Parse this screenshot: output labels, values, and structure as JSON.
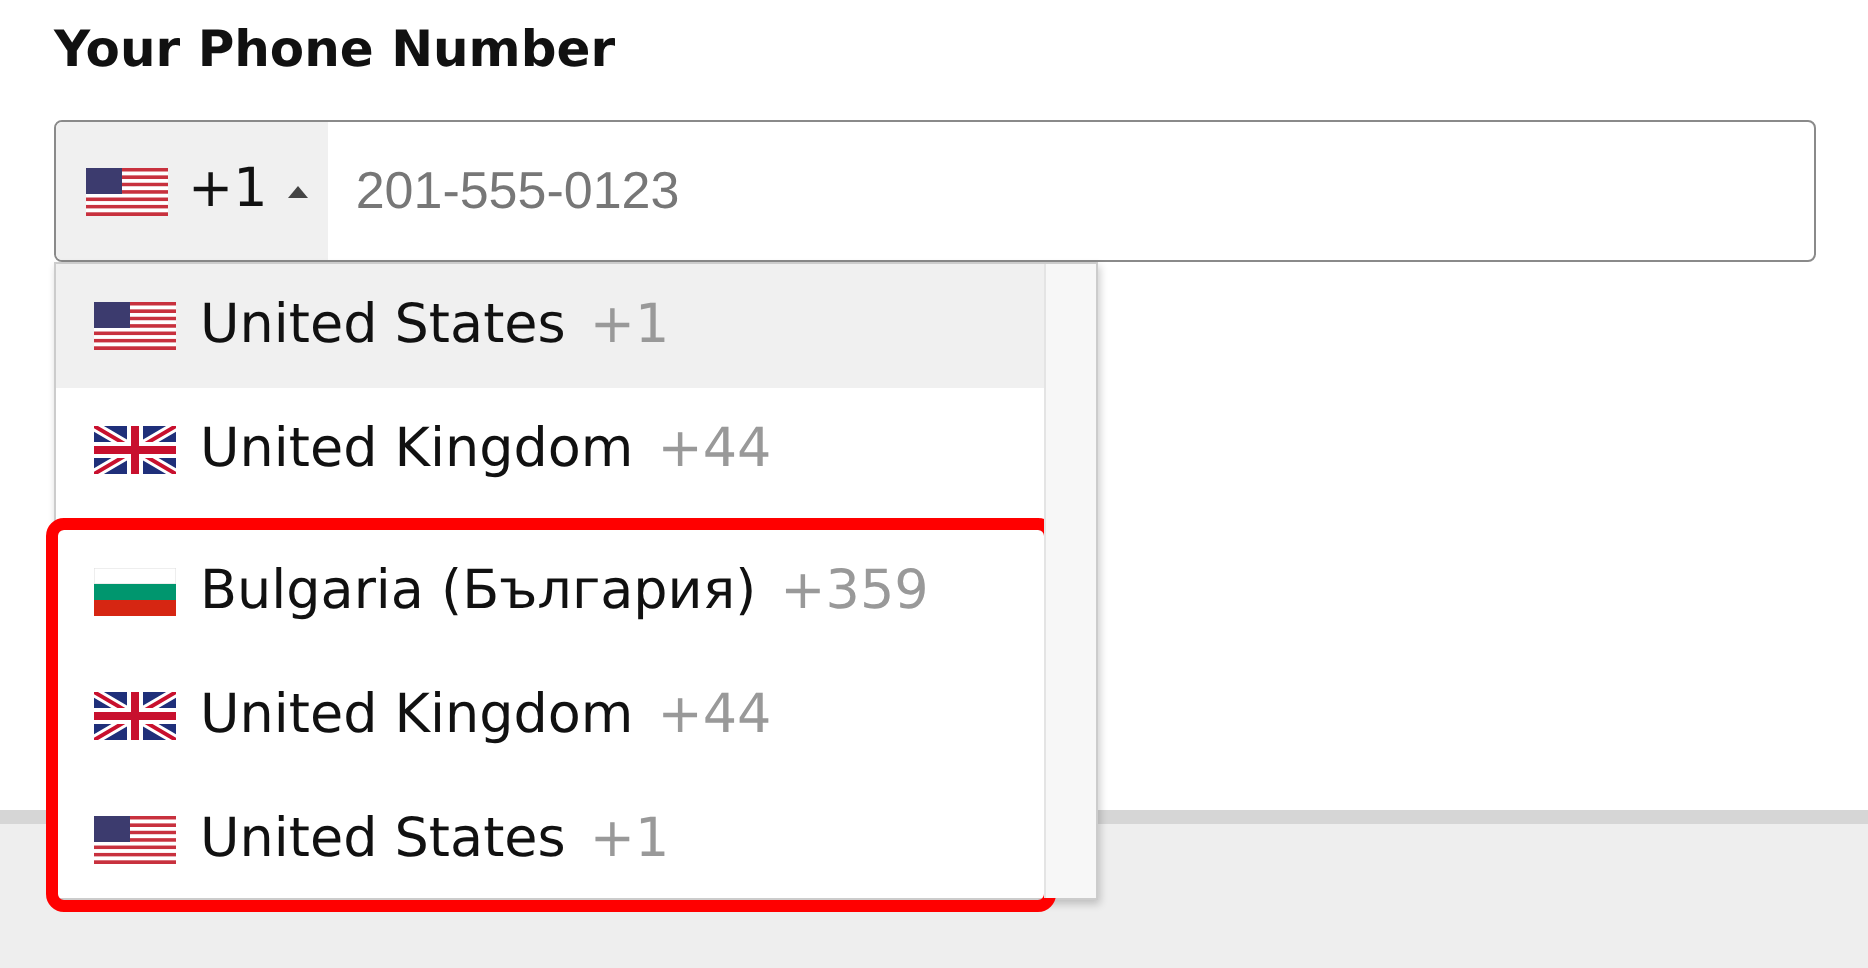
{
  "label": "Your Phone Number",
  "phone_field": {
    "dial_code": "+1",
    "kind": "us",
    "expanded": true,
    "placeholder": "201-555-0123"
  },
  "dropdown": {
    "groups": [
      {
        "highlighted": false,
        "items": [
          {
            "kind": "us",
            "name": "United States",
            "code": "+1",
            "selected": true
          },
          {
            "kind": "gb",
            "name": "United Kingdom",
            "code": "+44",
            "selected": false
          }
        ]
      },
      {
        "highlighted": true,
        "items": [
          {
            "kind": "bg",
            "name": "Bulgaria (България)",
            "code": "+359",
            "selected": false
          },
          {
            "kind": "gb",
            "name": "United Kingdom",
            "code": "+44",
            "selected": false
          },
          {
            "kind": "us",
            "name": "United States",
            "code": "+1",
            "selected": false
          }
        ]
      }
    ]
  }
}
